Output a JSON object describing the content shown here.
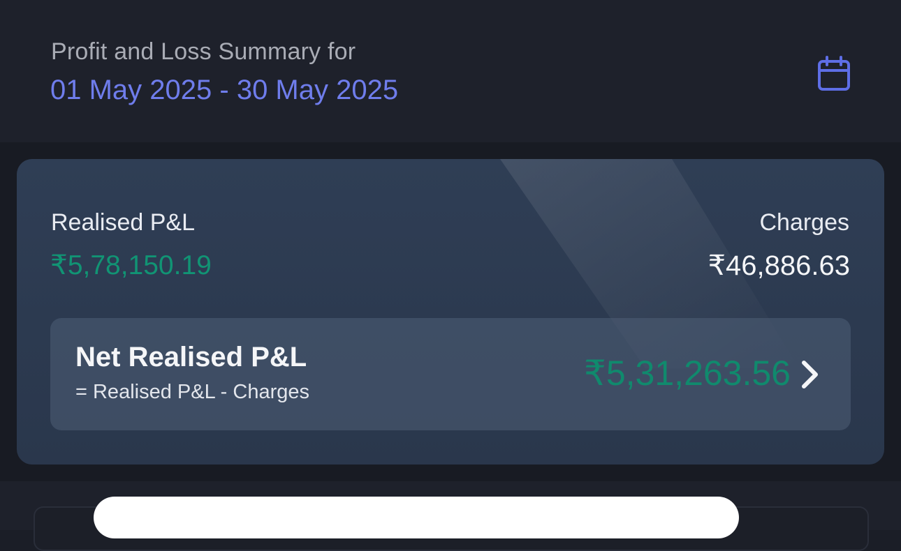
{
  "header": {
    "summary_label": "Profit and Loss Summary for",
    "date_range": "01 May 2025 - 30 May 2025",
    "calendar_icon": "calendar-icon"
  },
  "pl_card": {
    "realised_label": "Realised P&L",
    "realised_value": "₹5,78,150.19",
    "charges_label": "Charges",
    "charges_value": "₹46,886.63",
    "net": {
      "title": "Net Realised P&L",
      "formula": "= Realised P&L - Charges",
      "value": "₹5,31,263.56",
      "arrow_icon": "chevron-right-icon"
    }
  },
  "colors": {
    "accent": "#6f7dec",
    "profit": "#119474",
    "background": "#1b1e27",
    "card": "#2f3e55"
  }
}
